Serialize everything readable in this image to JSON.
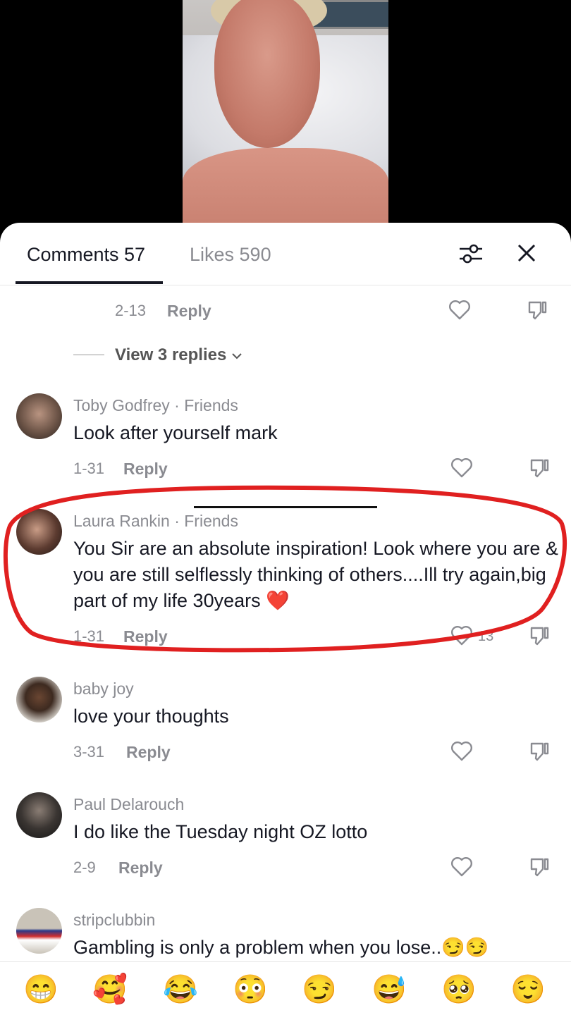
{
  "tabs": {
    "comments": "Comments 57",
    "likes": "Likes 590"
  },
  "partial_comment": {
    "date": "2-13",
    "reply": "Reply",
    "view_replies": "View 3 replies"
  },
  "comments": [
    {
      "author": "Toby Godfrey · Friends",
      "text": "Look after yourself mark",
      "date": "1-31",
      "reply": "Reply"
    },
    {
      "author": "Laura Rankin · Friends",
      "text": "You Sir are an absolute inspiration! Look where you are & you are still selflessly thinking of others....Ill try again,big part of my life 30years ❤️",
      "date": "1-31",
      "reply": "Reply",
      "likes": "13"
    },
    {
      "author": "baby joy",
      "text": "love your thoughts",
      "date": "3-31",
      "reply": "Reply"
    },
    {
      "author": "Paul Delarouch",
      "text": "I do like the Tuesday night OZ lotto",
      "date": "2-9",
      "reply": "Reply"
    },
    {
      "author": "stripclubbin",
      "text": "Gambling is only a problem when you lose..😏😏"
    }
  ],
  "emojis": [
    "😁",
    "🥰",
    "😂",
    "😳",
    "😏",
    "😅",
    "🥺",
    "😌"
  ],
  "icons": [
    "filter-icon",
    "close-icon",
    "heart-icon",
    "dislike-icon",
    "chevron-down-icon"
  ],
  "colors": {
    "annotation": "#e02020",
    "text": "#161823",
    "muted": "#8a8b91"
  }
}
